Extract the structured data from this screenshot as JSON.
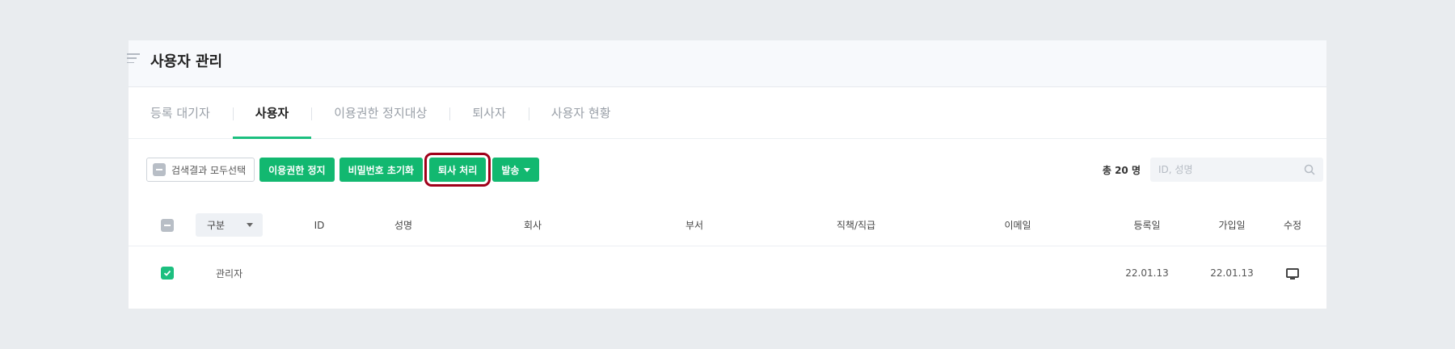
{
  "header": {
    "title": "사용자 관리"
  },
  "tabs": [
    {
      "label": "등록 대기자",
      "active": false
    },
    {
      "label": "사용자",
      "active": true
    },
    {
      "label": "이용권한 정지대상",
      "active": false
    },
    {
      "label": "퇴사자",
      "active": false
    },
    {
      "label": "사용자 현황",
      "active": false
    }
  ],
  "toolbar": {
    "select_all_label": "검색결과 모두선택",
    "suspend_label": "이용권한 정지",
    "reset_password_label": "비밀번호 초기화",
    "resign_label": "퇴사 처리",
    "send_label": "발송",
    "total_label": "총 20 명",
    "search_placeholder": "ID, 성명"
  },
  "table": {
    "filter_select_value": "구분",
    "columns": [
      "ID",
      "성명",
      "회사",
      "부서",
      "직책/직급",
      "이메일",
      "등록일",
      "가입일",
      "수정"
    ],
    "rows": [
      {
        "type": "관리자",
        "id": "",
        "name": "",
        "company": "",
        "department": "",
        "position": "",
        "email": "",
        "registered": "22.01.13",
        "joined": "22.01.13",
        "checked": true
      }
    ]
  },
  "colors": {
    "accent": "#12b870",
    "highlight": "#a0001a"
  }
}
